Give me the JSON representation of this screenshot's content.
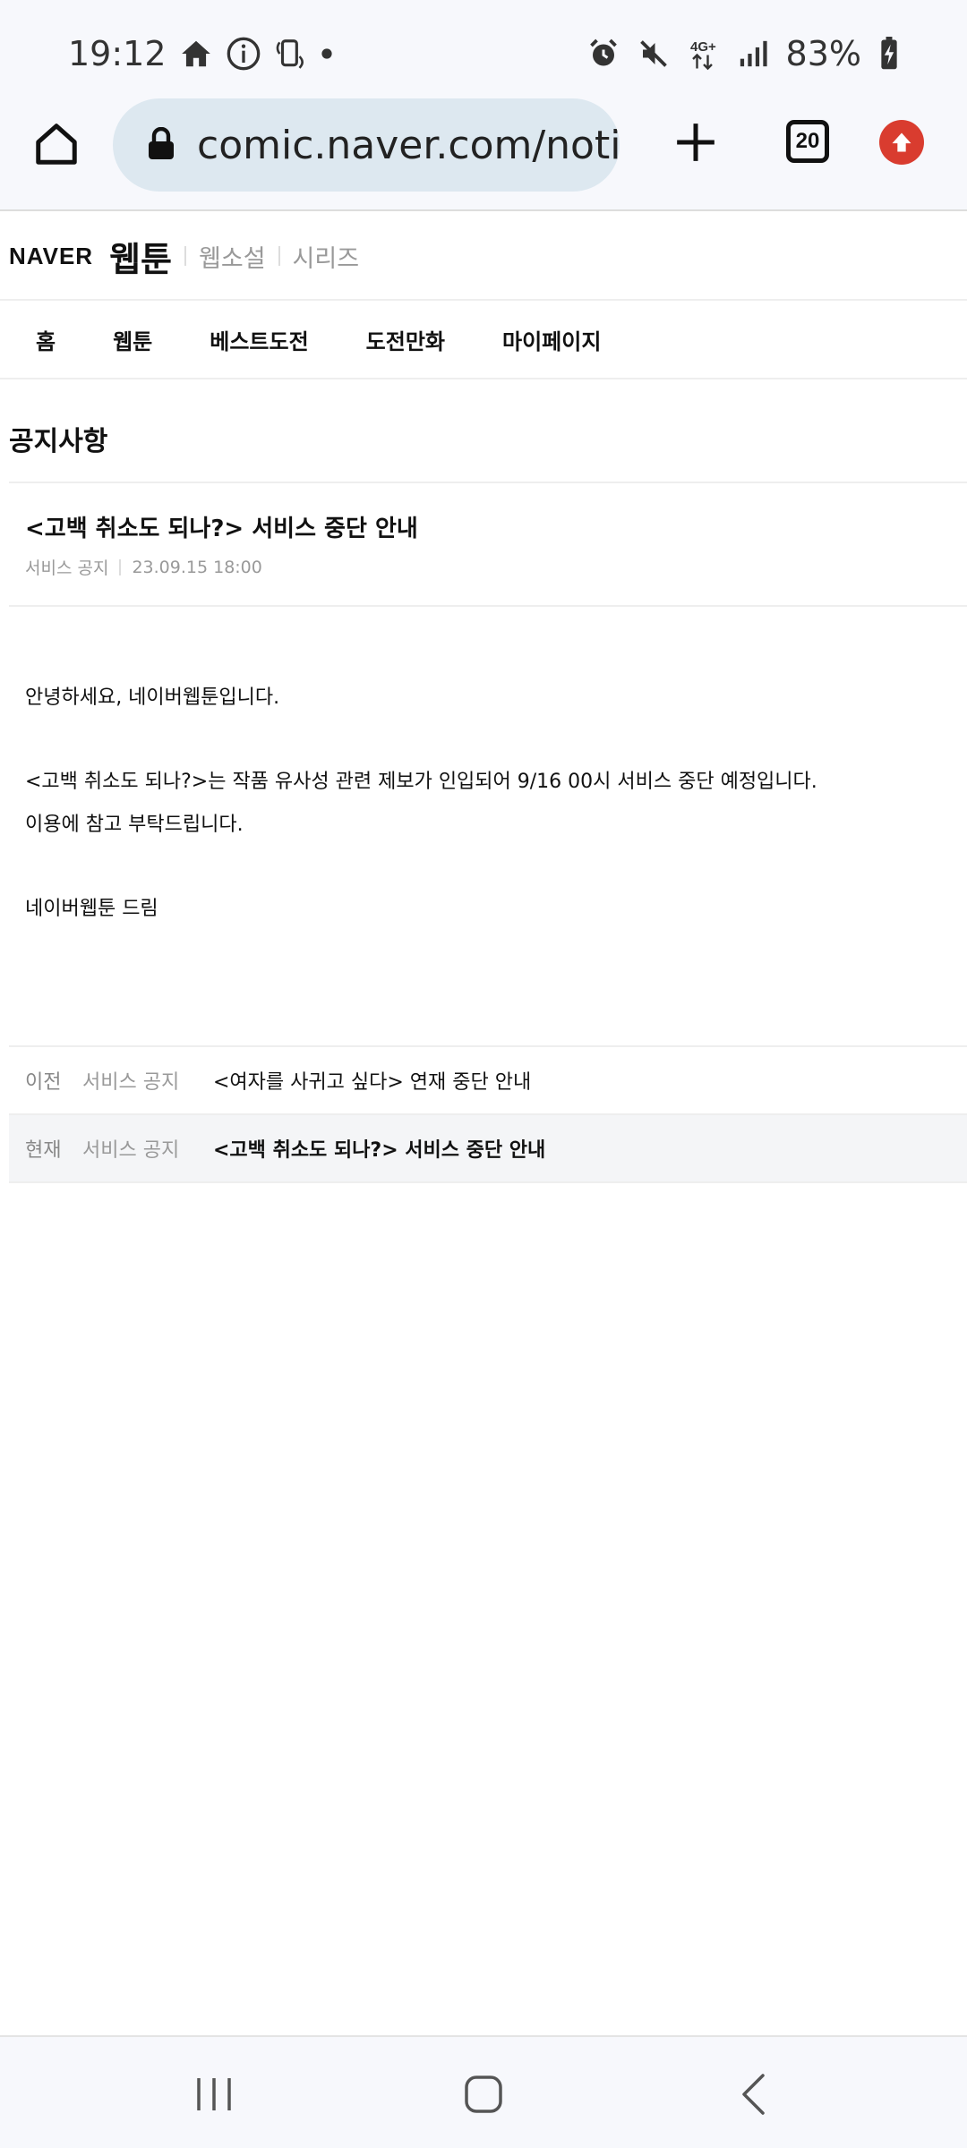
{
  "status": {
    "time": "19:12",
    "battery": "83%",
    "network": "4G+"
  },
  "browser": {
    "url": "comic.naver.com/notic",
    "tab_count": "20"
  },
  "header": {
    "brand": "NAVER",
    "service": "웹툰",
    "links": [
      "웹소설",
      "시리즈"
    ]
  },
  "gnb": [
    "홈",
    "웹툰",
    "베스트도전",
    "도전만화",
    "마이페이지"
  ],
  "page": {
    "section_title": "공지사항",
    "notice_title": "<고백 취소도 되나?> 서비스 중단 안내",
    "category": "서비스 공지",
    "date": "23.09.15 18:00",
    "body": {
      "greeting": "안녕하세요, 네이버웹툰입니다.",
      "line1": "<고백 취소도 되나?>는 작품 유사성 관련 제보가 인입되어 9/16 00시 서비스 중단 예정입니다.",
      "line2": "이용에 참고 부탁드립니다.",
      "sign": "네이버웹툰 드림"
    }
  },
  "nav_list": {
    "prev": {
      "pos": "이전",
      "category": "서비스 공지",
      "title": "<여자를 사귀고 싶다> 연재 중단 안내"
    },
    "current": {
      "pos": "현재",
      "category": "서비스 공지",
      "title": "<고백 취소도 되나?> 서비스 중단 안내"
    }
  },
  "colors": {
    "update_badge": "#d93c2f",
    "url_bg": "#dde8f0"
  }
}
